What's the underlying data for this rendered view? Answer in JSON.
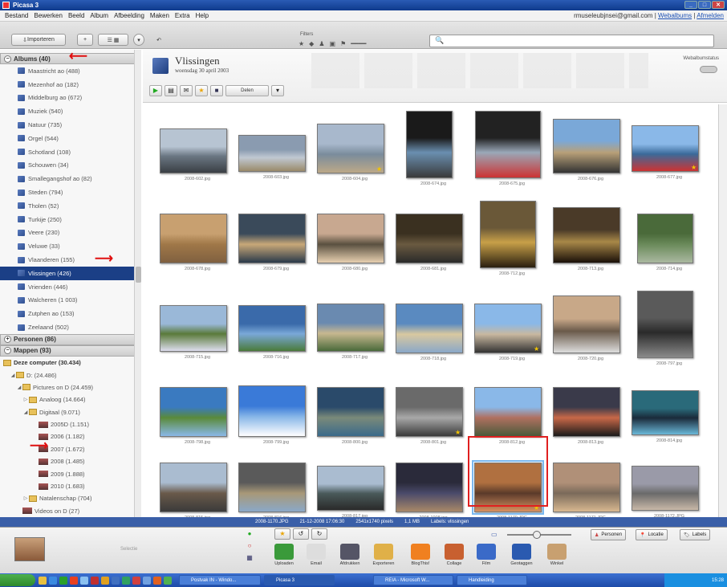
{
  "window": {
    "title": "Picasa 3"
  },
  "menu": {
    "items": [
      "Bestand",
      "Bewerken",
      "Beeld",
      "Album",
      "Afbeelding",
      "Maken",
      "Extra",
      "Help"
    ],
    "account": "rmuseleubjnsei@gmail.com",
    "account_links": [
      "Webalbums",
      "Afmelden"
    ]
  },
  "toolbar": {
    "import_label": "Importeren",
    "filters_label": "Filters",
    "search_placeholder": ""
  },
  "sidebar": {
    "albums_header": "Albums (40)",
    "albums": [
      {
        "label": "Maastricht ao (488)"
      },
      {
        "label": "Mezenhof ao (182)"
      },
      {
        "label": "Middelburg ao (672)"
      },
      {
        "label": "Muziek (540)"
      },
      {
        "label": "Natuur (735)"
      },
      {
        "label": "Orgel (544)"
      },
      {
        "label": "Schotland (108)"
      },
      {
        "label": "Schouwen (34)"
      },
      {
        "label": "Smallegangshof ao (82)"
      },
      {
        "label": "Steden (794)"
      },
      {
        "label": "Tholen (52)"
      },
      {
        "label": "Turkije (250)"
      },
      {
        "label": "Veere (230)"
      },
      {
        "label": "Veluwe (33)"
      },
      {
        "label": "Vlaanderen (155)"
      },
      {
        "label": "Vlissingen (426)"
      },
      {
        "label": "Vrienden (446)"
      },
      {
        "label": "Walcheren (1 003)"
      },
      {
        "label": "Zutphen ao (153)"
      },
      {
        "label": "Zeelaand (502)"
      }
    ],
    "people_header": "Personen (86)",
    "folders_header": "Mappen (93)",
    "computer": "Deze computer (30.434)",
    "tree": [
      {
        "label": "D: (24.486)",
        "icon": "folder",
        "arrow": "◢"
      },
      {
        "label": "Pictures on D (24.459)",
        "icon": "folder",
        "arrow": "◢"
      },
      {
        "label": "Analoog (14.664)",
        "icon": "folder",
        "arrow": "▷"
      },
      {
        "label": "Digitaal (9.071)",
        "icon": "folder",
        "arrow": "◢"
      },
      {
        "label": "2005D (1.151)",
        "icon": "thumb",
        "arrow": ""
      },
      {
        "label": "2006 (1.182)",
        "icon": "thumb",
        "arrow": ""
      },
      {
        "label": "2007 (1.672)",
        "icon": "thumb",
        "arrow": ""
      },
      {
        "label": "2008 (1.485)",
        "icon": "thumb",
        "arrow": ""
      },
      {
        "label": "2009 (1.888)",
        "icon": "thumb",
        "arrow": ""
      },
      {
        "label": "2010 (1.683)",
        "icon": "thumb",
        "arrow": ""
      },
      {
        "label": "Natalenschap (704)",
        "icon": "folder",
        "arrow": "▷"
      },
      {
        "label": "Videos on D (27)",
        "icon": "thumb",
        "arrow": ""
      },
      {
        "label": "Pictures (5.948)",
        "icon": "thumb",
        "arrow": "◢"
      }
    ]
  },
  "album": {
    "title": "Vlissingen",
    "date": "woensdag 30 april 2003",
    "share_label": "Delen",
    "webalbum_label": "Webalbumstatus"
  },
  "photos": [
    [
      "2008-602.jpg",
      "2008-603.jpg",
      "2008-604.jpg",
      "2008-674.jpg",
      "2008-675.jpg",
      "2008-676.jpg",
      "2008-677.jpg"
    ],
    [
      "2008-678.jpg",
      "2008-679.jpg",
      "2008-680.jpg",
      "2008-681.jpg",
      "2008-712.jpg",
      "2008-713.jpg",
      "2008-714.jpg"
    ],
    [
      "2008-715.jpg",
      "2008-716.jpg",
      "2008-717.jpg",
      "2008-718.jpg",
      "2008-719.jpg",
      "2008-720.jpg",
      "2008-797.jpg"
    ],
    [
      "2008-798.jpg",
      "2008-799.jpg",
      "2008-800.jpg",
      "2008-801.jpg",
      "2008-812.jpg",
      "2008-813.jpg",
      "2008-814.jpg"
    ],
    [
      "2008-815.jpg",
      "2008-816.jpg",
      "2008-817.jpg",
      "2008-1008.jpg",
      "2008-1170.JPG",
      "2008-1171.JPG",
      "2008-1172.JPG"
    ]
  ],
  "status": {
    "file": "2008-1170.JPG",
    "datetime": "21-12-2008 17:06:30",
    "size": "2541x1740 pixels",
    "mb": "1,1 MB",
    "labels": "Labels: vlissingen"
  },
  "tray": {
    "selection_label": "Selectie",
    "tools": [
      "Uploaden",
      "Email",
      "Afdrukken",
      "Exporteren",
      "BlogThis!",
      "Collage",
      "Film",
      "Geotaggen",
      "Winkel"
    ],
    "right_buttons": [
      "Personen",
      "Locatie",
      "Labels"
    ]
  },
  "taskbar": {
    "tasks": [
      "Postvak IN - Windo...",
      "Picasa 3",
      "REIA - Microsoft W...",
      "Handleiding"
    ],
    "clock": "15:28"
  },
  "colors": {
    "selected_album": "#1b3f86",
    "highlight": "#e02020",
    "arrow": "#e01010"
  }
}
